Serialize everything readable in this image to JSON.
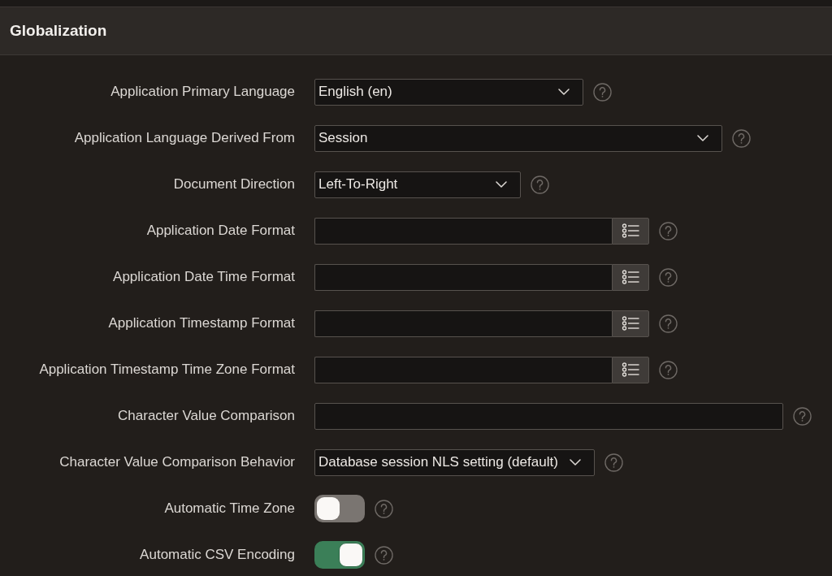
{
  "section": {
    "title": "Globalization"
  },
  "fields": [
    {
      "label": "Application Primary Language",
      "kind": "select",
      "value": "English (en)"
    },
    {
      "label": "Application Language Derived From",
      "kind": "select",
      "value": "Session"
    },
    {
      "label": "Document Direction",
      "kind": "select",
      "value": "Left-To-Right"
    },
    {
      "label": "Application Date Format",
      "kind": "lov"
    },
    {
      "label": "Application Date Time Format",
      "kind": "lov"
    },
    {
      "label": "Application Timestamp Format",
      "kind": "lov"
    },
    {
      "label": "Application Timestamp Time Zone Format",
      "kind": "lov"
    },
    {
      "label": "Character Value Comparison",
      "kind": "text"
    },
    {
      "label": "Character Value Comparison Behavior",
      "kind": "select",
      "value": "Database session NLS setting (default)"
    },
    {
      "label": "Automatic Time Zone",
      "kind": "toggle",
      "on": false
    },
    {
      "label": "Automatic CSV Encoding",
      "kind": "toggle",
      "on": true
    }
  ]
}
